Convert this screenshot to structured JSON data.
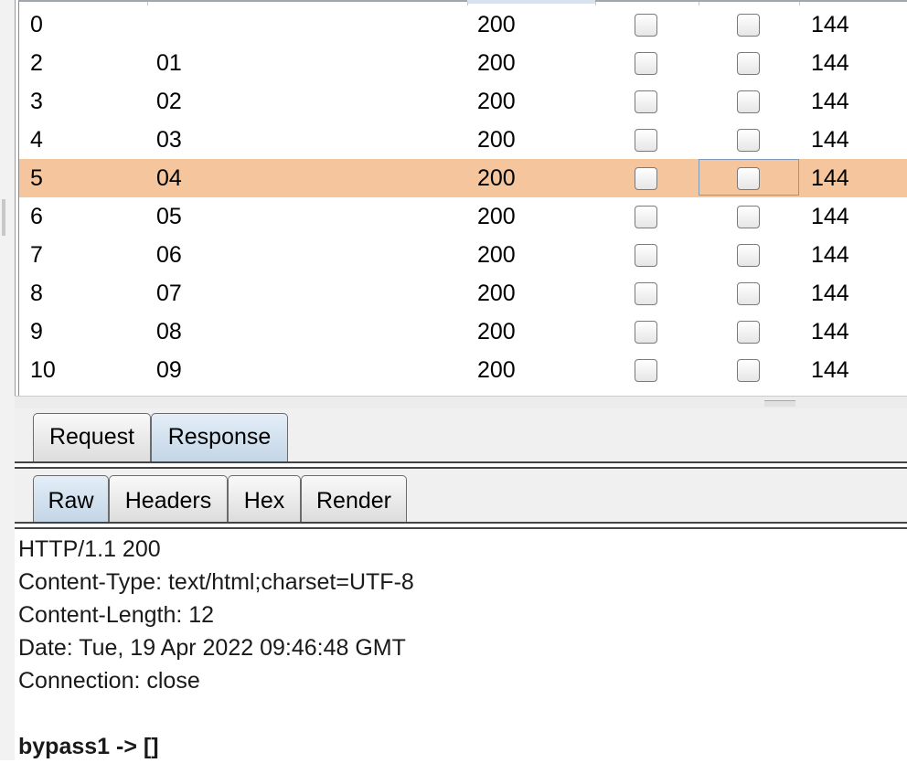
{
  "table": {
    "rows": [
      {
        "num": "0",
        "payload": "",
        "status": "200",
        "length": "144",
        "selected": false
      },
      {
        "num": "2",
        "payload": "01",
        "status": "200",
        "length": "144",
        "selected": false
      },
      {
        "num": "3",
        "payload": "02",
        "status": "200",
        "length": "144",
        "selected": false
      },
      {
        "num": "4",
        "payload": "03",
        "status": "200",
        "length": "144",
        "selected": false
      },
      {
        "num": "5",
        "payload": "04",
        "status": "200",
        "length": "144",
        "selected": true
      },
      {
        "num": "6",
        "payload": "05",
        "status": "200",
        "length": "144",
        "selected": false
      },
      {
        "num": "7",
        "payload": "06",
        "status": "200",
        "length": "144",
        "selected": false
      },
      {
        "num": "8",
        "payload": "07",
        "status": "200",
        "length": "144",
        "selected": false
      },
      {
        "num": "9",
        "payload": "08",
        "status": "200",
        "length": "144",
        "selected": false
      },
      {
        "num": "10",
        "payload": "09",
        "status": "200",
        "length": "144",
        "selected": false
      }
    ],
    "selected_row_color": "#f5c59d"
  },
  "outer_tabs": {
    "request": "Request",
    "response": "Response",
    "active": "response"
  },
  "inner_tabs": {
    "raw": "Raw",
    "headers": "Headers",
    "hex": "Hex",
    "render": "Render",
    "active": "raw"
  },
  "response": {
    "status_line": "HTTP/1.1 200",
    "content_type": "Content-Type: text/html;charset=UTF-8",
    "content_length": "Content-Length: 12",
    "date": "Date: Tue, 19 Apr 2022 09:46:48 GMT",
    "connection": "Connection: close",
    "body": "bypass1 -> []"
  }
}
